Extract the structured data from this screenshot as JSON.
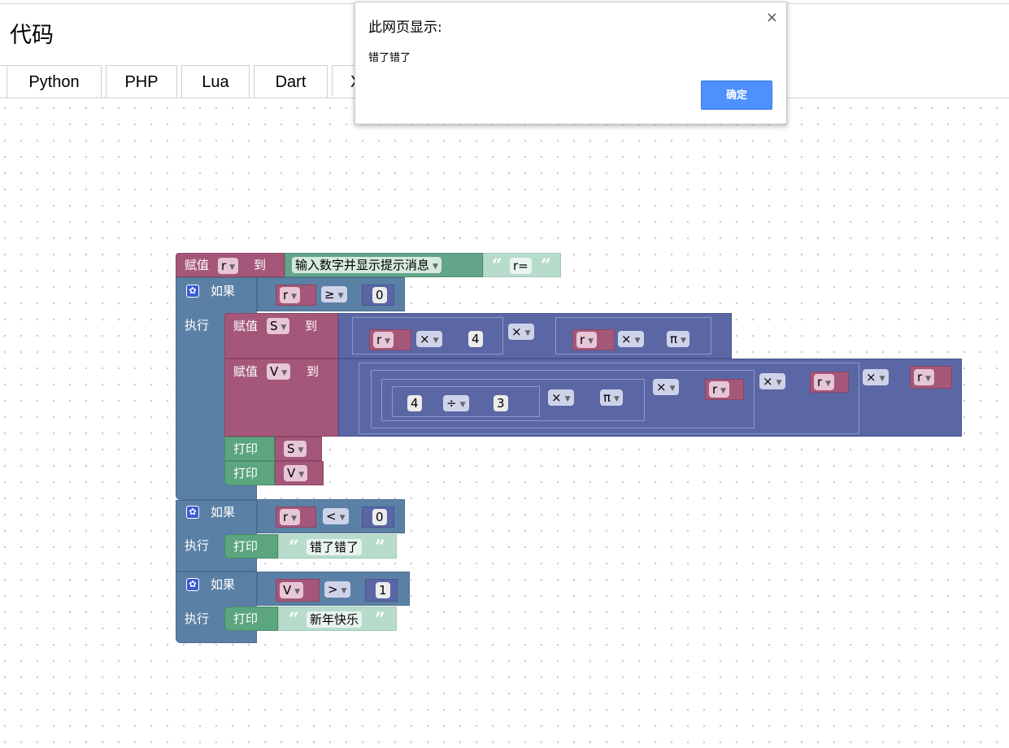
{
  "page": {
    "title": "代码"
  },
  "tabs": [
    "Python",
    "PHP",
    "Lua",
    "Dart",
    "X"
  ],
  "dialog": {
    "title": "此网页显示:",
    "message": "错了错了",
    "ok_label": "确定",
    "close_glyph": "×"
  },
  "blocks": {
    "assign_label": "赋值",
    "to_label": "到",
    "if_label": "如果",
    "do_label": "执行",
    "print_label": "打印",
    "prompt_label": "输入数字并显示提示消息",
    "prompt_text": "r=",
    "open_quote": "“",
    "close_quote": "”",
    "var_r": "r",
    "var_s": "S",
    "var_v": "V",
    "op_ge": "≥",
    "op_lt": "<",
    "op_gt": ">",
    "op_times": "×",
    "op_div": "÷",
    "const_pi": "π",
    "num_0": "0",
    "num_1": "1",
    "num_3": "3",
    "num_4": "4",
    "msg_error": "错了错了",
    "msg_newyear": "新年快乐"
  },
  "colors": {
    "variables": "#a5577a",
    "control": "#5b80a5",
    "math": "#5b67a5",
    "text": "#5ba57f",
    "dialog_button": "#4d90fe"
  }
}
